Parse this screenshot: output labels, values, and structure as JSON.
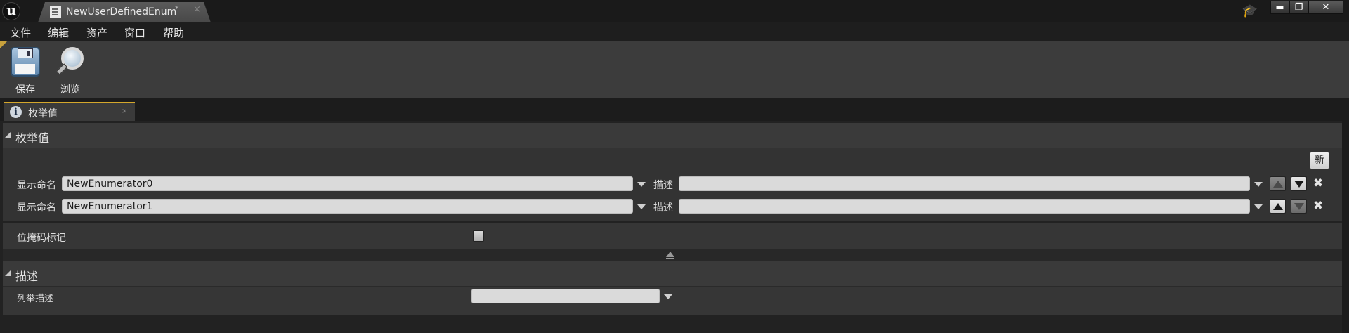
{
  "app": {
    "logo_letter": "u",
    "tab_title": "NewUserDefinedEnum",
    "tab_dirty_marker": "*",
    "tab_close": "×",
    "window_buttons": {
      "minimize": "▬",
      "maximize": "❐",
      "close": "✕"
    }
  },
  "menu": [
    "文件",
    "编辑",
    "资产",
    "窗口",
    "帮助"
  ],
  "toolbar": {
    "save_label": "保存",
    "browse_label": "浏览"
  },
  "details_tab": {
    "icon_letter": "i",
    "label": "枚举值",
    "close": "×"
  },
  "enum_section": {
    "title": "枚举值",
    "new_button": "新",
    "enumerators": [
      {
        "label": "显示命名",
        "value": "NewEnumerator0",
        "desc_label": "描述",
        "description": "",
        "move_up_enabled": false,
        "move_down_enabled": true,
        "delete": "✖"
      },
      {
        "label": "显示命名",
        "value": "NewEnumerator1",
        "desc_label": "描述",
        "description": "",
        "move_up_enabled": true,
        "move_down_enabled": false,
        "delete": "✖"
      }
    ],
    "bitmask_label": "位掩码标记",
    "bitmask_checked": false
  },
  "description_section": {
    "title": "描述",
    "enum_description_label": "列举描述",
    "enum_description_value": ""
  }
}
